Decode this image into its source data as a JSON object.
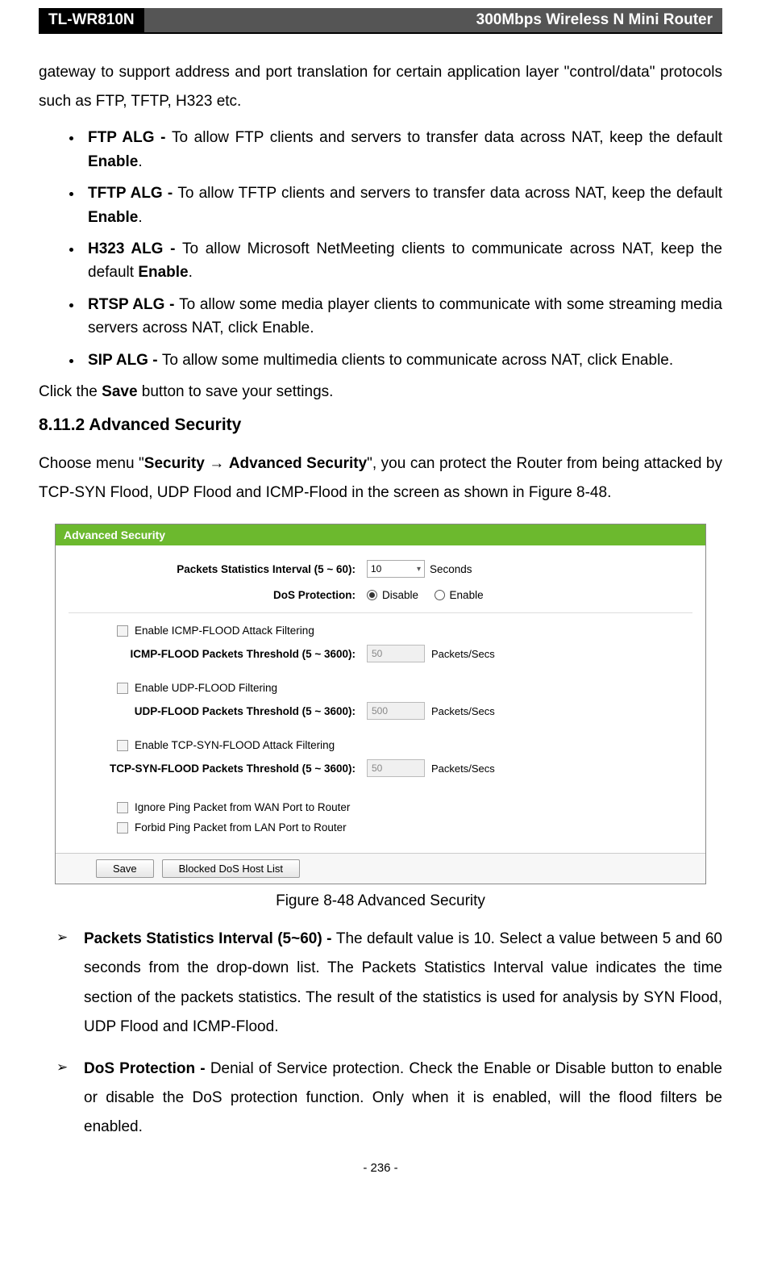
{
  "header": {
    "model": "TL-WR810N",
    "title": "300Mbps Wireless N Mini Router"
  },
  "intro": "gateway to support address and port translation for certain application layer \"control/data\" protocols such as FTP, TFTP, H323 etc.",
  "alg_items": [
    {
      "label": "FTP ALG - ",
      "text": "To allow FTP clients and servers to transfer data across NAT, keep the default ",
      "bold_tail": "Enable",
      "tail": "."
    },
    {
      "label": "TFTP ALG - ",
      "text": "To allow TFTP clients and servers to transfer data across NAT, keep the default ",
      "bold_tail": "Enable",
      "tail": "."
    },
    {
      "label": "H323 ALG - ",
      "text": "To allow Microsoft NetMeeting clients to communicate across NAT, keep the default ",
      "bold_tail": "Enable",
      "tail": "."
    },
    {
      "label": "RTSP ALG - ",
      "text": "To allow some media player clients to communicate with some streaming media servers across NAT, click Enable.",
      "bold_tail": "",
      "tail": ""
    },
    {
      "label": "SIP ALG - ",
      "text": "To allow some multimedia clients to communicate across NAT, click Enable.",
      "bold_tail": "",
      "tail": ""
    }
  ],
  "save_line_pre": "Click the ",
  "save_line_bold": "Save",
  "save_line_post": " button to save your settings.",
  "section_heading": "8.11.2 Advanced Security",
  "menu_line_pre": "Choose menu \"",
  "menu_line_bold1": "Security",
  "menu_line_arrow": " → ",
  "menu_line_bold2": "Advanced Security",
  "menu_line_post": "\", you can protect the Router from being attacked by TCP-SYN Flood, UDP Flood and ICMP-Flood in the screen as shown in Figure 8-48.",
  "panel": {
    "title": "Advanced Security",
    "interval_label": "Packets Statistics Interval (5 ~ 60):",
    "interval_value": "10",
    "interval_unit": "Seconds",
    "dos_label": "DoS Protection:",
    "dos_disable": "Disable",
    "dos_enable": "Enable",
    "icmp_chk": "Enable ICMP-FLOOD Attack Filtering",
    "icmp_label": "ICMP-FLOOD Packets Threshold (5 ~ 3600):",
    "icmp_val": "50",
    "udp_chk": "Enable UDP-FLOOD Filtering",
    "udp_label": "UDP-FLOOD Packets Threshold (5 ~ 3600):",
    "udp_val": "500",
    "tcp_chk": "Enable TCP-SYN-FLOOD Attack Filtering",
    "tcp_label": "TCP-SYN-FLOOD Packets Threshold (5 ~ 3600):",
    "tcp_val": "50",
    "unit": "Packets/Secs",
    "ping_wan": "Ignore Ping Packet from WAN Port to Router",
    "ping_lan": "Forbid Ping Packet from LAN Port to Router",
    "btn_save": "Save",
    "btn_blocked": "Blocked DoS Host List"
  },
  "figure_caption": "Figure 8-48 Advanced Security",
  "desc_items": [
    {
      "label": "Packets Statistics Interval (5~60) - ",
      "text": "The default value is 10. Select a value between 5 and 60 seconds from the drop-down list. The Packets Statistics Interval value indicates the time section of the packets statistics. The result of the statistics is used for analysis by SYN Flood, UDP Flood and ICMP-Flood."
    },
    {
      "label": "DoS Protection - ",
      "text": "Denial of Service protection. Check the Enable or Disable button to enable or disable the DoS protection function. Only when it is enabled, will the flood filters be enabled."
    }
  ],
  "page_number": "- 236 -"
}
